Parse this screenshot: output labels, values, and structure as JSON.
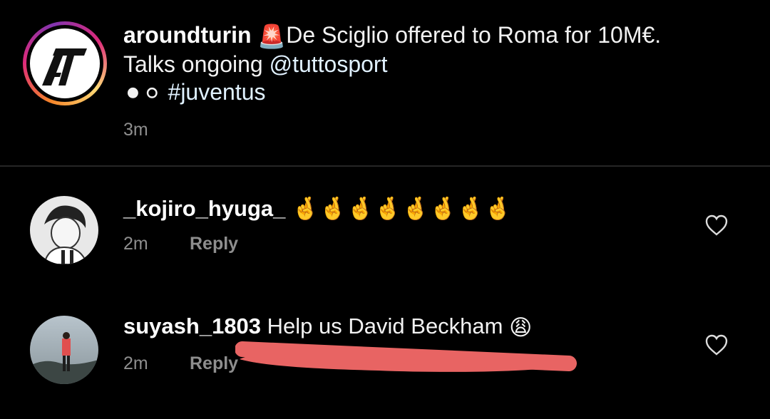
{
  "post": {
    "username": "aroundturin",
    "alert_emoji": "🚨",
    "caption_line1": "De Sciglio offered to Roma for 10M€.",
    "caption_line2_text": "Talks ongoing ",
    "mention": "@tuttosport",
    "ball_emojis": "⚫⚪",
    "hashtag": "#juventus",
    "time": "3m",
    "avatar_icon": "at-logo-icon"
  },
  "comments": [
    {
      "username": "_kojiro_hyuga_",
      "text": "🤞🤞🤞🤞🤞🤞🤞🤞",
      "time": "2m",
      "reply": "Reply",
      "like_icon": "heart-outline-icon"
    },
    {
      "username": "suyash_1803",
      "text": "Help us David Beckham",
      "emoji": "😩",
      "time": "2m",
      "reply": "Reply",
      "like_icon": "heart-outline-icon"
    }
  ],
  "colors": {
    "background": "#000000",
    "text": "#ffffff",
    "muted": "#8e8e8e",
    "link": "#e0f1ff",
    "redaction": "#e86463"
  }
}
